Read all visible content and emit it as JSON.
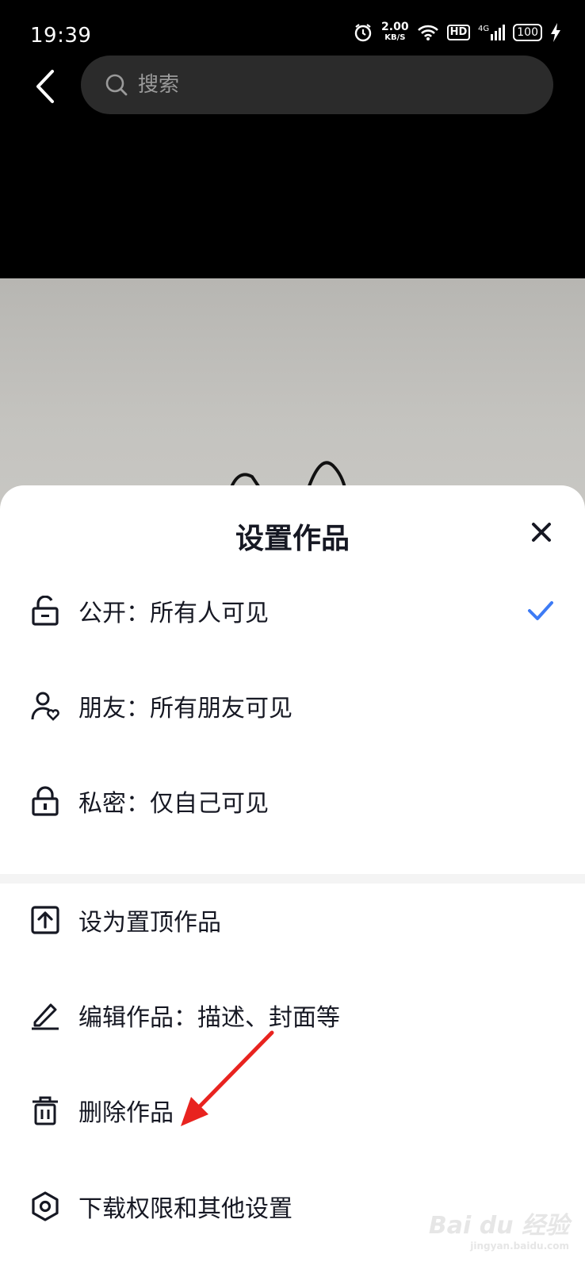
{
  "status_bar": {
    "time": "19:39",
    "net_speed": "2.00",
    "net_unit": "KB/S",
    "hd": "HD",
    "signal": "4G",
    "battery": "100"
  },
  "search": {
    "placeholder": "搜索"
  },
  "sheet": {
    "title": "设置作品",
    "privacy_options": [
      {
        "label": "公开：所有人可见",
        "icon": "unlock-icon",
        "selected": true
      },
      {
        "label": "朋友：所有朋友可见",
        "icon": "friend-heart-icon",
        "selected": false
      },
      {
        "label": "私密：仅自己可见",
        "icon": "lock-icon",
        "selected": false
      }
    ],
    "actions": [
      {
        "label": "设为置顶作品",
        "icon": "pin-top-icon"
      },
      {
        "label": "编辑作品：描述、封面等",
        "icon": "pencil-icon"
      },
      {
        "label": "删除作品",
        "icon": "trash-icon"
      },
      {
        "label": "下载权限和其他设置",
        "icon": "settings-hexagon-icon"
      }
    ]
  },
  "colors": {
    "accent_check": "#3d7bf5",
    "annotation_arrow": "#e8231f"
  },
  "watermark": {
    "brand": "Bai du 经验",
    "domain": "jingyan.baidu.com"
  }
}
